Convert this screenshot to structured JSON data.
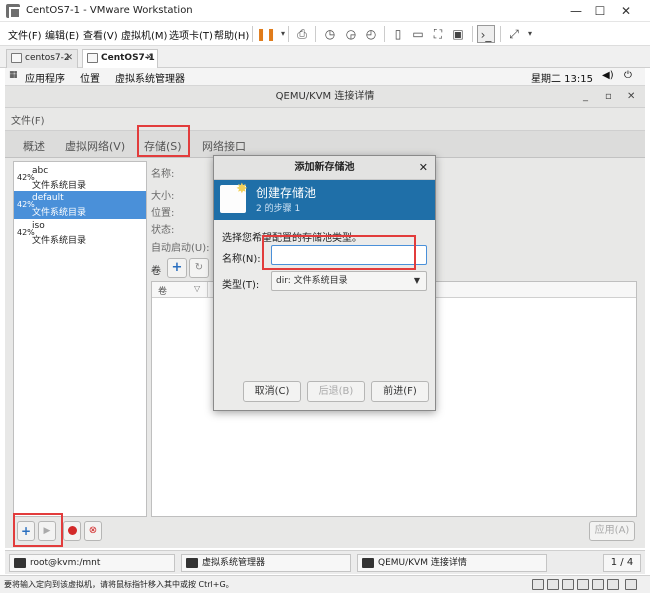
{
  "vmware": {
    "window_title": "CentOS7-1 - VMware Workstation",
    "menu": [
      "文件(F)",
      "编辑(E)",
      "查看(V)",
      "虚拟机(M)",
      "选项卡(T)",
      "帮助(H)"
    ],
    "tabs": [
      {
        "label": "centos7-2",
        "active": false
      },
      {
        "label": "CentOS7-1",
        "active": true
      }
    ],
    "status_text": "要将输入定向到该虚拟机，请将鼠标指针移入其中或按 Ctrl+G。"
  },
  "gnome": {
    "apps": "应用程序",
    "places": "位置",
    "current_app": "虚拟系统管理器",
    "clock": "星期二 13:15"
  },
  "app": {
    "title": "QEMU/KVM 连接详情",
    "menu_file": "文件(F)",
    "tabs": [
      "概述",
      "虚拟网络(V)",
      "存储(S)",
      "网络接口"
    ],
    "pools": [
      {
        "pct": "42%",
        "name": "abc",
        "type": "文件系统目录",
        "selected": false
      },
      {
        "pct": "42%",
        "name": "default",
        "type": "文件系统目录",
        "selected": true
      },
      {
        "pct": "42%",
        "name": "iso",
        "type": "文件系统目录",
        "selected": false
      }
    ],
    "details": {
      "name_label": "名称:",
      "size_label": "大小:",
      "location_label": "位置:",
      "state_label": "状态:",
      "autostart_label": "自动启动(U):",
      "volumes_label": "卷",
      "volumes_column": "卷"
    },
    "apply_button": "应用(A)"
  },
  "dialog": {
    "title": "添加新存储池",
    "banner_title": "创建存储池",
    "banner_step": "2 的步骤 1",
    "prompt": "选择您希望配置的存储池类型。",
    "name_label": "名称(N):",
    "name_value": "",
    "type_label": "类型(T):",
    "type_value": "dir: 文件系统目录",
    "cancel": "取消(C)",
    "back": "后退(B)",
    "forward": "前进(F)"
  },
  "taskbar": {
    "items": [
      "root@kvm:/mnt",
      "虚拟系统管理器",
      "QEMU/KVM 连接详情"
    ],
    "workspace": "1 / 4"
  },
  "colors": {
    "selection_blue": "#4a90d9",
    "banner_blue": "#1f6fa8",
    "highlight_red": "#e23c3c"
  }
}
